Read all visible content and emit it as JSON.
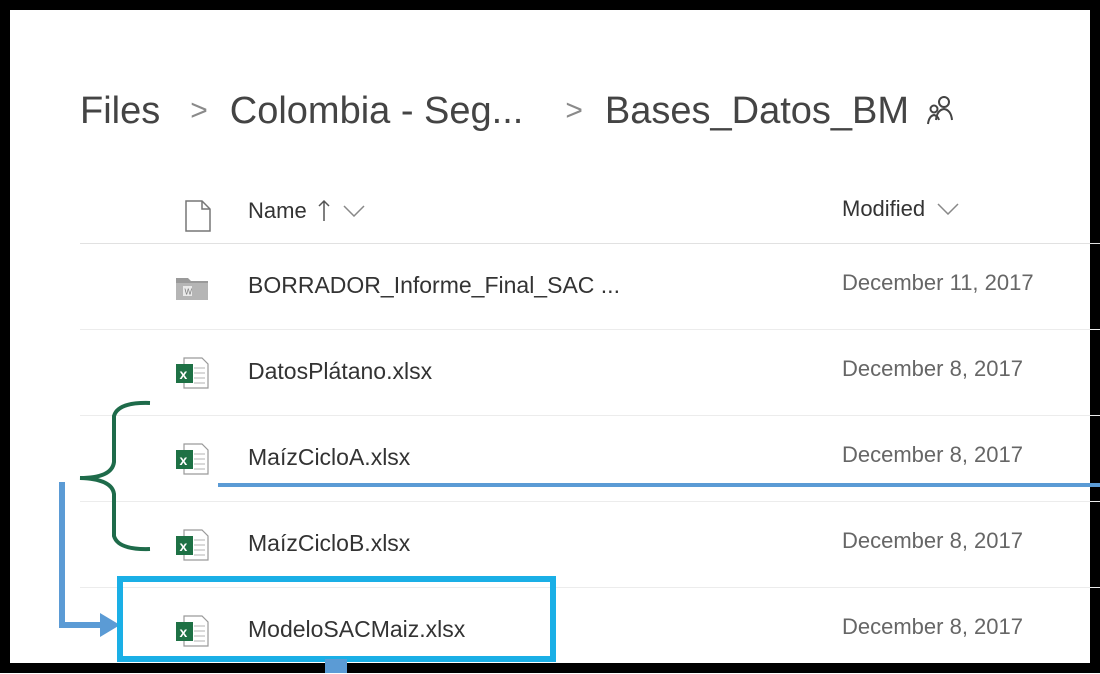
{
  "breadcrumb": {
    "items": [
      "Files",
      "Colombia - Seg...",
      "Bases_Datos_BM"
    ],
    "separator": ">"
  },
  "columns": {
    "name": "Name",
    "name_sort": "↑",
    "modified": "Modified"
  },
  "files": [
    {
      "name": "BORRADOR_Informe_Final_SAC ...",
      "modified": "December 11, 2017",
      "icon": "folder-icon"
    },
    {
      "name": "DatosPlátano.xlsx",
      "modified": "December 8, 2017",
      "icon": "excel-file-icon"
    },
    {
      "name": "MaízCicloA.xlsx",
      "modified": "December 8, 2017",
      "icon": "excel-file-icon"
    },
    {
      "name": "MaízCicloB.xlsx",
      "modified": "December 8, 2017",
      "icon": "excel-file-icon"
    },
    {
      "name": "ModeloSACMaiz.xlsx",
      "modified": "December 8, 2017",
      "icon": "excel-file-icon"
    }
  ],
  "annotations": {
    "brace_color": "#1e6b4a",
    "arrow_color": "#5b9bd5",
    "highlight_color": "#1aafe6"
  },
  "colors": {
    "excel_green": "#1e7145"
  }
}
